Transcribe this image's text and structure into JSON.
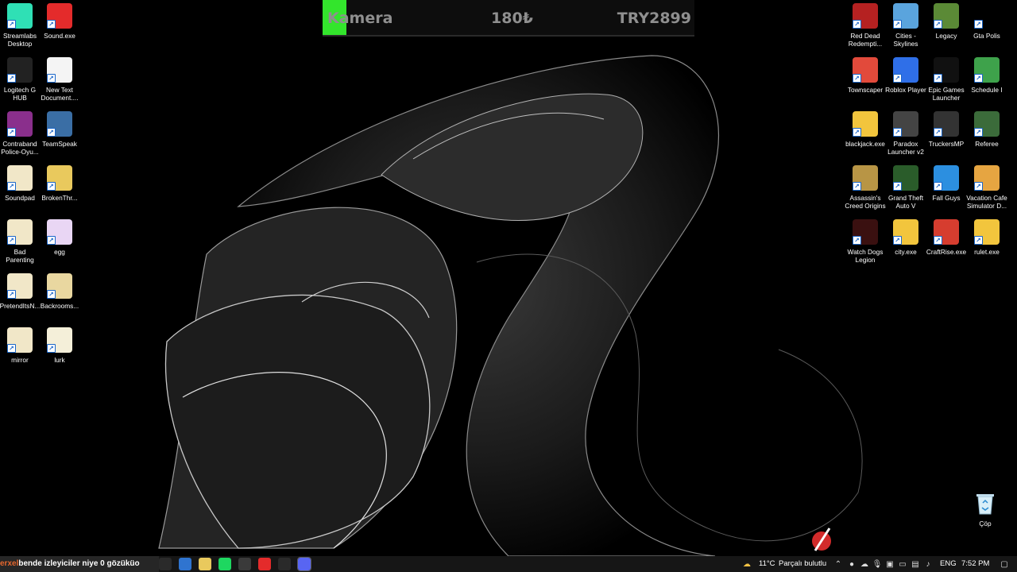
{
  "widget": {
    "title": "Kamera",
    "price": "180₺",
    "goal": "TRY2899",
    "progress_fraction": 0.065,
    "bar_color": "#33e52c"
  },
  "desktop_left": [
    {
      "label": "Streamlabs Desktop",
      "icon": "streamlabs-icon",
      "color": "#2fe0b5"
    },
    {
      "label": "Sound.exe",
      "icon": "youtube-icon",
      "color": "#e42b2b"
    },
    {
      "label": "Logitech G HUB",
      "icon": "logitech-icon",
      "color": "#222222"
    },
    {
      "label": "New Text Document....",
      "icon": "text-file-icon",
      "color": "#f4f4f4"
    },
    {
      "label": "Contraband Police-Oyu...",
      "icon": "winrar-icon",
      "color": "#8a2f8c"
    },
    {
      "label": "TeamSpeak",
      "icon": "teamspeak-icon",
      "color": "#3a6ea5"
    },
    {
      "label": "Soundpad",
      "icon": "file-icon",
      "color": "#f1e7c8"
    },
    {
      "label": "BrokenThr...",
      "icon": "folder-icon",
      "color": "#e9c95d"
    },
    {
      "label": "Bad Parenting",
      "icon": "file-icon",
      "color": "#f1e7c8"
    },
    {
      "label": "egg",
      "icon": "file-icon",
      "color": "#e9d6f4"
    },
    {
      "label": "PretendItsN...",
      "icon": "file-icon",
      "color": "#f1e7c8"
    },
    {
      "label": "Backrooms...",
      "icon": "file-icon",
      "color": "#e9d7a0"
    },
    {
      "label": "mirror",
      "icon": "file-icon",
      "color": "#f1e7c8"
    },
    {
      "label": "lurk",
      "icon": "file-icon",
      "color": "#f4efd9"
    }
  ],
  "desktop_right": [
    {
      "label": "Red Dead Redempti...",
      "icon": "red-dead-icon",
      "color": "#b52121"
    },
    {
      "label": "Cities - Skylines",
      "icon": "cities-skylines-icon",
      "color": "#5aa4dd"
    },
    {
      "label": "Legacy",
      "icon": "minecraft-icon",
      "color": "#5b8a36"
    },
    {
      "label": "Gta Polis",
      "icon": "rage-icon",
      "color": "#000000"
    },
    {
      "label": "Townscaper",
      "icon": "townscaper-icon",
      "color": "#e24a3b"
    },
    {
      "label": "Roblox Player",
      "icon": "roblox-icon",
      "color": "#2f6fe8"
    },
    {
      "label": "Epic Games Launcher",
      "icon": "epic-games-icon",
      "color": "#111111"
    },
    {
      "label": "Schedule I",
      "icon": "schedule-icon",
      "color": "#3ea24b"
    },
    {
      "label": "blackjack.exe",
      "icon": "python-icon",
      "color": "#f2c53d"
    },
    {
      "label": "Paradox Launcher v2",
      "icon": "paradox-icon",
      "color": "#444444"
    },
    {
      "label": "TruckersMP",
      "icon": "truckersmp-icon",
      "color": "#333333"
    },
    {
      "label": "Referee",
      "icon": "referee-icon",
      "color": "#3b6b3a"
    },
    {
      "label": "Assassin's Creed Origins",
      "icon": "assassins-creed-icon",
      "color": "#b89545"
    },
    {
      "label": "Grand Theft Auto V",
      "icon": "gta-v-icon",
      "color": "#2a5c2a"
    },
    {
      "label": "Fall Guys",
      "icon": "fall-guys-icon",
      "color": "#2c8fe0"
    },
    {
      "label": "Vacation Cafe Simulator D...",
      "icon": "vacation-cafe-icon",
      "color": "#e6a541"
    },
    {
      "label": "Watch Dogs Legion",
      "icon": "watch-dogs-icon",
      "color": "#3a1010"
    },
    {
      "label": "city.exe",
      "icon": "python-icon",
      "color": "#f2c53d"
    },
    {
      "label": "CraftRise.exe",
      "icon": "craftrise-icon",
      "color": "#d63d2f"
    },
    {
      "label": "rulet.exe",
      "icon": "python-icon",
      "color": "#f2c53d"
    }
  ],
  "recycle_bin": {
    "label": "Çöp",
    "icon": "recycle-bin-icon"
  },
  "taskbar": {
    "ticker_brand": "erxel",
    "ticker_text": "bende izleyiciler niye 0 gözüküo",
    "apps": [
      {
        "icon": "task-view-icon",
        "color": "#2a2a2a"
      },
      {
        "icon": "chrome-icon",
        "color": "#2f74d0"
      },
      {
        "icon": "file-explorer-icon",
        "color": "#e9c95d"
      },
      {
        "icon": "spotify-icon",
        "color": "#1ed760"
      },
      {
        "icon": "obs-icon",
        "color": "#3a3a3a"
      },
      {
        "icon": "youtube-icon",
        "color": "#e42b2b"
      },
      {
        "icon": "steam-icon",
        "color": "#2a2a2a"
      },
      {
        "icon": "discord-icon",
        "color": "#5865f2"
      }
    ],
    "weather": {
      "temp": "11°C",
      "condition": "Parçalı bulutlu"
    },
    "language": "ENG",
    "time": "7:52 PM"
  }
}
